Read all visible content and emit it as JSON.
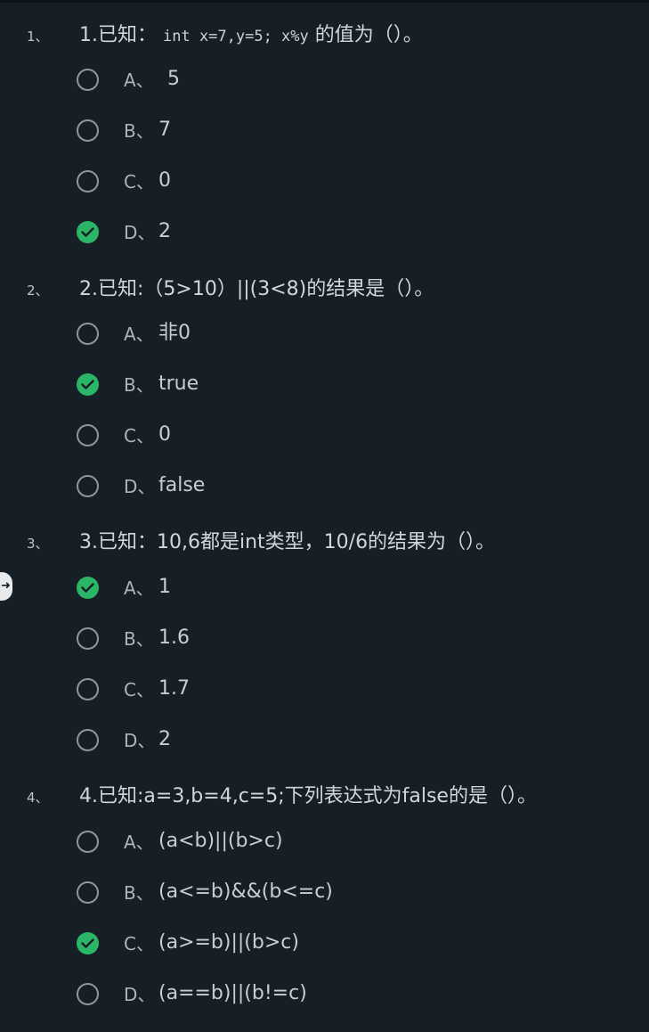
{
  "questions": [
    {
      "number": "1、",
      "text_prefix": "1.已知：",
      "text_code": "int x=7,y=5;  x%y",
      "text_suffix": " 的值为（）。",
      "options": [
        {
          "letter": "A、",
          "text": " 5",
          "checked": false
        },
        {
          "letter": "B、",
          "text": "7",
          "checked": false
        },
        {
          "letter": "C、",
          "text": "0",
          "checked": false
        },
        {
          "letter": "D、",
          "text": "2",
          "checked": true
        }
      ]
    },
    {
      "number": "2、",
      "text_prefix": "2.已知:（5>10）||(3<8)的结果是（）。",
      "text_code": "",
      "text_suffix": "",
      "options": [
        {
          "letter": "A、",
          "text": "非0",
          "checked": false
        },
        {
          "letter": "B、",
          "text": "true",
          "checked": true
        },
        {
          "letter": "C、",
          "text": "0",
          "checked": false
        },
        {
          "letter": "D、",
          "text": "false",
          "checked": false
        }
      ]
    },
    {
      "number": "3、",
      "text_prefix": "3.已知：10,6都是int类型，10/6的结果为（）。",
      "text_code": "",
      "text_suffix": "",
      "options": [
        {
          "letter": "A、",
          "text": "1",
          "checked": true
        },
        {
          "letter": "B、",
          "text": "1.6",
          "checked": false
        },
        {
          "letter": "C、",
          "text": "1.7",
          "checked": false
        },
        {
          "letter": "D、",
          "text": "2",
          "checked": false
        }
      ]
    },
    {
      "number": "4、",
      "text_prefix": "4.已知:a=3,b=4,c=5;下列表达式为false的是（）。",
      "text_code": "",
      "text_suffix": "",
      "options": [
        {
          "letter": "A、",
          "text": "(a<b)||(b>c)",
          "checked": false
        },
        {
          "letter": "B、",
          "text": "(a<=b)&&(b<=c)",
          "checked": false
        },
        {
          "letter": "C、",
          "text": "(a>=b)||(b>c)",
          "checked": true
        },
        {
          "letter": "D、",
          "text": "(a==b)||(b!=c)",
          "checked": false
        }
      ]
    }
  ],
  "side_handle_icon": "arrow-right-icon",
  "colors": {
    "background": "#161e26",
    "checked": "#2bb567",
    "radio_border": "#8f969c"
  }
}
